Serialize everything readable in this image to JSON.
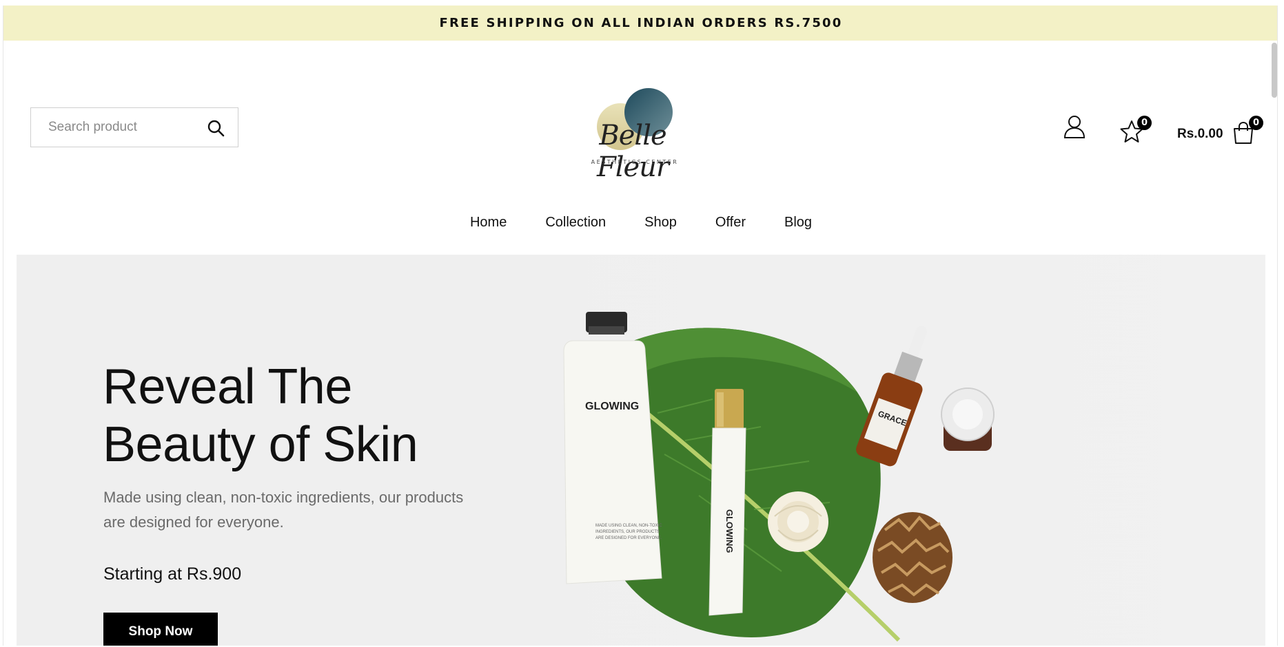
{
  "announcement": {
    "text": "FREE SHIPPING ON ALL INDIAN ORDERS RS.7500"
  },
  "search": {
    "placeholder": "Search product"
  },
  "logo": {
    "name": "Belle Fleur",
    "tagline": "AESTHETICS CENTER"
  },
  "header": {
    "wishlist_count": "0",
    "cart_total": "Rs.0.00",
    "cart_count": "0"
  },
  "nav": {
    "items": [
      "Home",
      "Collection",
      "Shop",
      "Offer",
      "Blog"
    ]
  },
  "hero": {
    "title_line1": "Reveal The",
    "title_line2": "Beauty of Skin",
    "description": "Made using clean, non-toxic ingredients, our products are designed for everyone.",
    "price_text": "Starting at Rs.900",
    "cta_label": "Shop Now",
    "product_texts": {
      "tube_large": "GLOWING",
      "tube_small": "GLOWING",
      "bottle": "GRACE"
    }
  },
  "colors": {
    "announcement_bg": "#f3f1c6",
    "button_bg": "#000000",
    "hero_bg": "#efefef",
    "leaf": "#3d7a2a"
  }
}
